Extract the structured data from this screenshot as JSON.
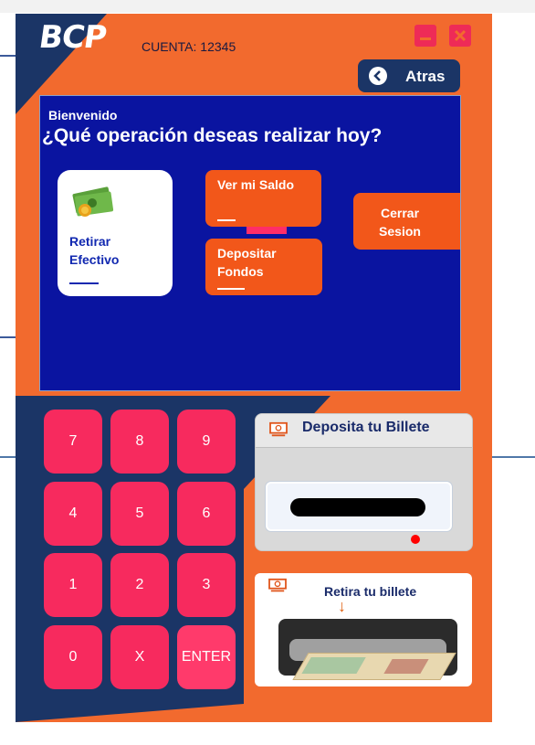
{
  "header": {
    "brand": "BCP",
    "account_label": "CUENTA: 12345",
    "back_label": "Atras"
  },
  "main": {
    "welcome": "Bienvenido",
    "question": "¿Qué operación deseas realizar hoy?",
    "options": {
      "withdraw": "Retirar Efectivo",
      "balance": "Ver mi Saldo",
      "deposit": "Depositar Fondos",
      "logout": "Cerrar Sesion"
    }
  },
  "keypad": {
    "keys": [
      "7",
      "8",
      "9",
      "4",
      "5",
      "6",
      "1",
      "2",
      "3",
      "0",
      "X",
      "ENTER"
    ]
  },
  "deposit_box": {
    "title": "Deposita tu Billete"
  },
  "withdraw_box": {
    "title": "Retira tu billete",
    "arrow": "↓"
  },
  "colors": {
    "window_orange": "#f26a2e",
    "navy": "#1b3566",
    "panel_blue": "#0a14a0",
    "key_pink": "#f72a5e",
    "button_orange": "#f2571a"
  },
  "icons": {
    "minimize": "minimize-icon",
    "close": "close-icon",
    "back": "chevron-left-icon",
    "cash": "cash-money-icon",
    "banknote": "banknote-icon"
  }
}
